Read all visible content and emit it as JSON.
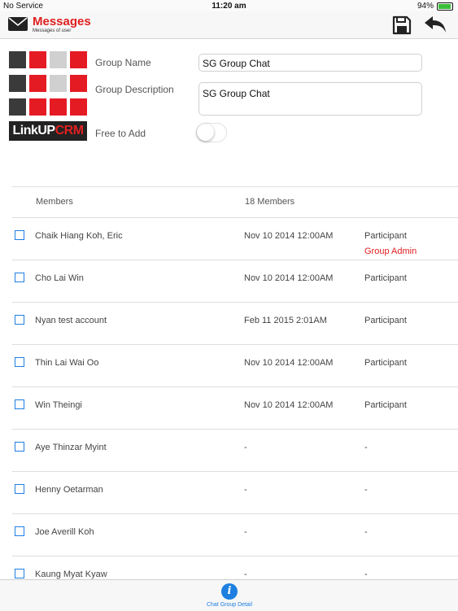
{
  "status_bar": {
    "carrier": "No Service",
    "time": "11:20 am",
    "battery": "94%",
    "battery_level": 0.94
  },
  "nav": {
    "title": "Messages",
    "subtitle": "Messages of user",
    "brand_color": "#e02020"
  },
  "logo": {
    "text_white": "LinkUP",
    "text_red": "CRM"
  },
  "form": {
    "group_name_label": "Group Name",
    "group_name_value": "SG Group Chat",
    "group_description_label": "Group Description",
    "group_description_value": "SG Group Chat",
    "free_to_add_label": "Free to Add",
    "free_to_add_on": false
  },
  "members": {
    "header_label": "Members",
    "count_label": "18 Members",
    "rows": [
      {
        "name": "Chaik Hiang Koh, Eric",
        "date": "Nov 10 2014 12:00AM",
        "role": "Participant",
        "extra": "Group Admin"
      },
      {
        "name": "Cho Lai Win",
        "date": "Nov 10 2014 12:00AM",
        "role": "Participant",
        "extra": ""
      },
      {
        "name": "Nyan test account",
        "date": "Feb 11 2015  2:01AM",
        "role": "Participant",
        "extra": ""
      },
      {
        "name": "Thin Lai Wai Oo",
        "date": "Nov 10 2014 12:00AM",
        "role": "Participant",
        "extra": ""
      },
      {
        "name": "Win Theingi",
        "date": "Nov 10 2014 12:00AM",
        "role": "Participant",
        "extra": ""
      },
      {
        "name": "Aye Thinzar Myint",
        "date": "-",
        "role": "-",
        "extra": ""
      },
      {
        "name": "Henny Oetarman",
        "date": "-",
        "role": "-",
        "extra": ""
      },
      {
        "name": "Joe Averill Koh",
        "date": "-",
        "role": "-",
        "extra": ""
      },
      {
        "name": "Kaung Myat Kyaw",
        "date": "-",
        "role": "-",
        "extra": ""
      }
    ]
  },
  "tab_bar": {
    "active_label": "Chat Group Detail",
    "accent_color": "#1e7fe0"
  }
}
